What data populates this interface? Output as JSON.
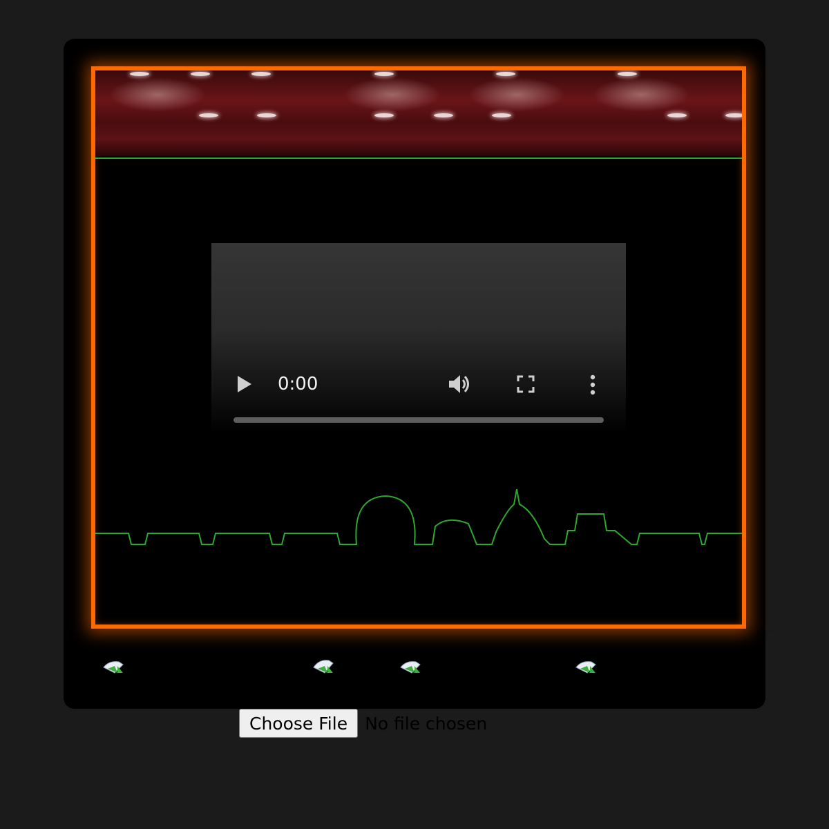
{
  "video_player": {
    "current_time": "0:00",
    "progress_percent": 0,
    "controls": [
      "play-icon",
      "volume-icon",
      "fullscreen-icon",
      "more-options-icon"
    ]
  },
  "thumbnails": {
    "icon": "broken-image-icon",
    "count": 4
  },
  "file_input": {
    "button_label": "Choose File",
    "status_text": "No file chosen"
  },
  "colors": {
    "page_background": "#1b1b1b",
    "frame_border": "#ff6a00",
    "seat_outline": "#2fa82f",
    "curtain": "#6a1518"
  }
}
